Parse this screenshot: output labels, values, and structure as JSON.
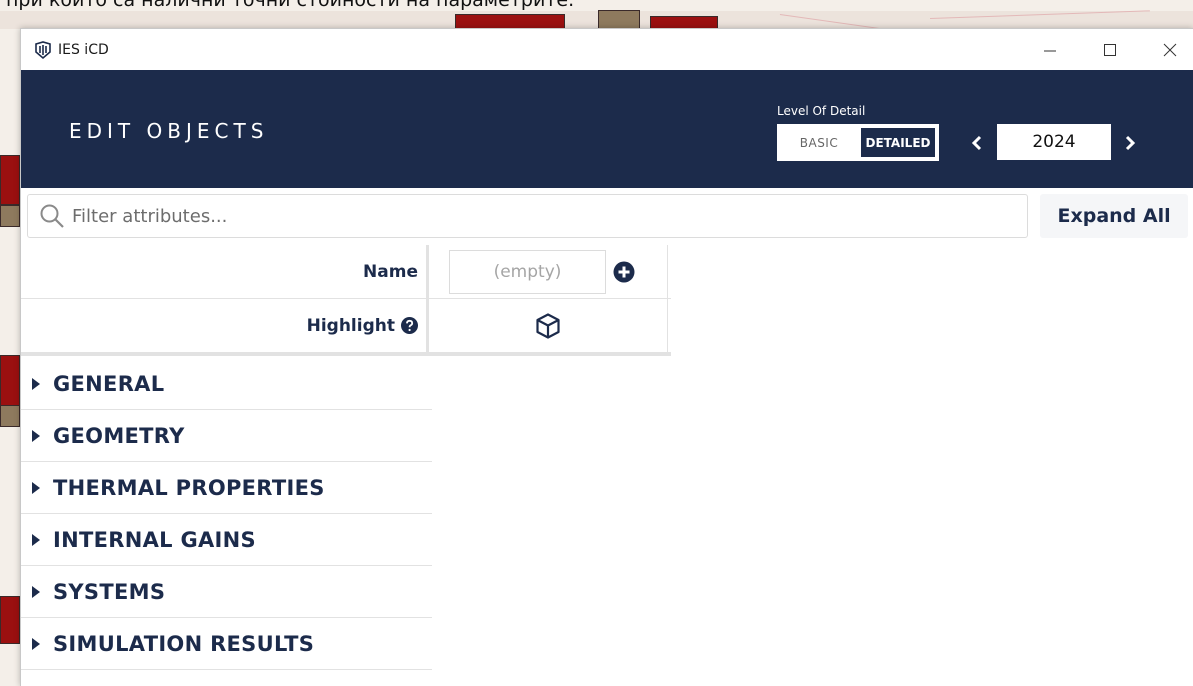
{
  "background": {
    "text": "при които са налични точни стойности на параметрите."
  },
  "window": {
    "title": "IES iCD",
    "controls": [
      "minimize-icon",
      "maximize-icon",
      "close-icon"
    ]
  },
  "header": {
    "title": "EDIT OBJECTS",
    "lod_label": "Level Of Detail",
    "lod_basic": "BASIC",
    "lod_detailed": "DETAILED",
    "lod_selected": "DETAILED",
    "year": "2024"
  },
  "filter": {
    "placeholder": "Filter attributes...",
    "value": "",
    "expand_all_label": "Expand All"
  },
  "attributes": {
    "name_label": "Name",
    "name_placeholder": "(empty)",
    "highlight_label": "Highlight"
  },
  "sections": [
    {
      "label": "GENERAL"
    },
    {
      "label": "GEOMETRY"
    },
    {
      "label": "THERMAL PROPERTIES"
    },
    {
      "label": "INTERNAL GAINS"
    },
    {
      "label": "SYSTEMS"
    },
    {
      "label": "SIMULATION RESULTS"
    }
  ],
  "colors": {
    "header_bg": "#1c2b4b",
    "accent": "#1c2b4b",
    "background_red": "#9b1010",
    "background_tan": "#8e7a5e"
  }
}
